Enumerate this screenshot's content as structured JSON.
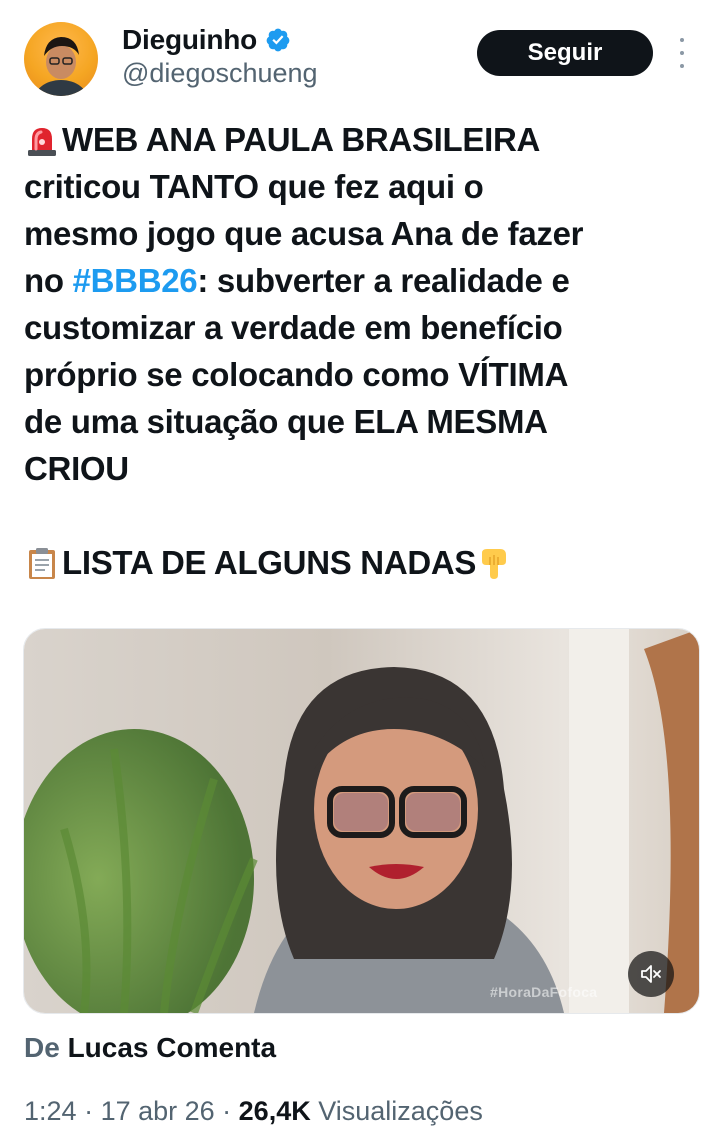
{
  "author": {
    "display_name": "Dieguinho",
    "handle": "@diegoschueng",
    "verified_icon": "verified-badge-icon",
    "avatar": "avatar-photo"
  },
  "actions": {
    "follow_label": "Seguir",
    "more_icon": "more-vertical-icon"
  },
  "tweet": {
    "lines": [
      "WEB ANA PAULA BRASILEIRA",
      "criticou TANTO que fez aqui o",
      "mesmo jogo que acusa Ana de fazer",
      "no ",
      "#BBB26",
      ": subverter a realidade e",
      "customizar a verdade em benefício",
      "próprio se colocando como VÍTIMA",
      "de uma situação que ELA MESMA",
      "CRIOU",
      "LISTA DE ALGUNS NADAS"
    ],
    "emojis": [
      "siren-emoji",
      "clipboard-emoji",
      "pointing-down-emoji"
    ]
  },
  "media": {
    "watermark": "#HoraDaFofoca",
    "mute_icon": "speaker-muted-icon"
  },
  "source": {
    "prefix": "De",
    "author": "Lucas Comenta"
  },
  "meta": {
    "time": "1:24",
    "date": "17 abr 26",
    "views_count": "26,4K",
    "views_label": "Visualizações"
  },
  "colors": {
    "accent": "#1d9bf0",
    "text": "#0f1419",
    "secondary": "#536471",
    "button": "#0f1419"
  }
}
